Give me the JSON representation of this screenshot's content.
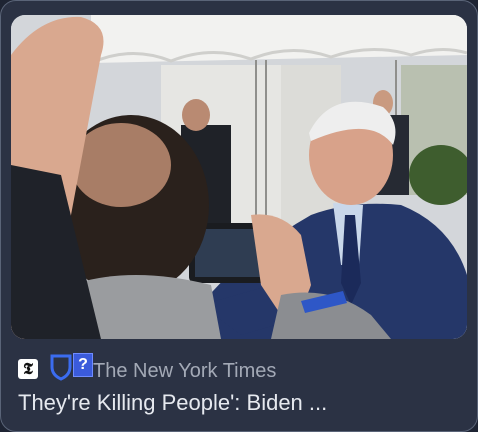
{
  "card": {
    "source_name": "The New York Times",
    "headline": "They're Killing People': Biden ...",
    "source_logo_icon": "nyt-logo-icon",
    "shield_icon": "shield-icon",
    "unknown_badge_label": "?"
  },
  "colors": {
    "card_background": "#2b3244",
    "card_border": "#5a6478",
    "headline_text": "#e6e9ef",
    "source_text": "#a3a9b6",
    "badge_blue": "#3b5bdb"
  }
}
